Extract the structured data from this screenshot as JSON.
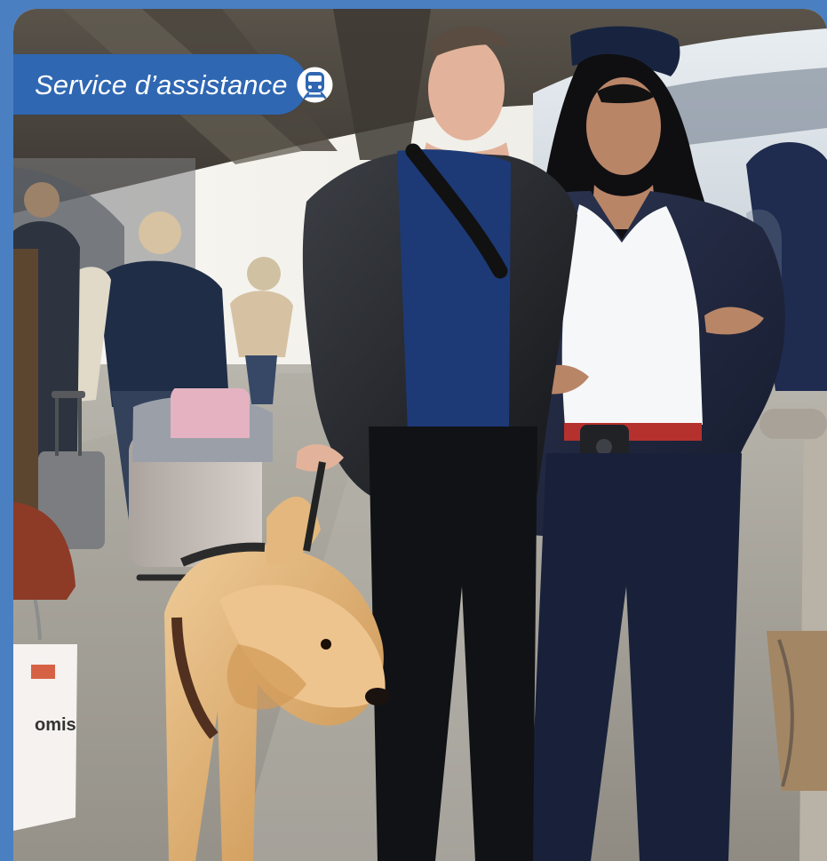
{
  "header": {
    "title": "Service d’assistance",
    "icon": "train-icon",
    "accent_color": "#2f67b2",
    "border_color": "#4a7fc1"
  },
  "photo": {
    "bag_logo_text": "omis"
  }
}
